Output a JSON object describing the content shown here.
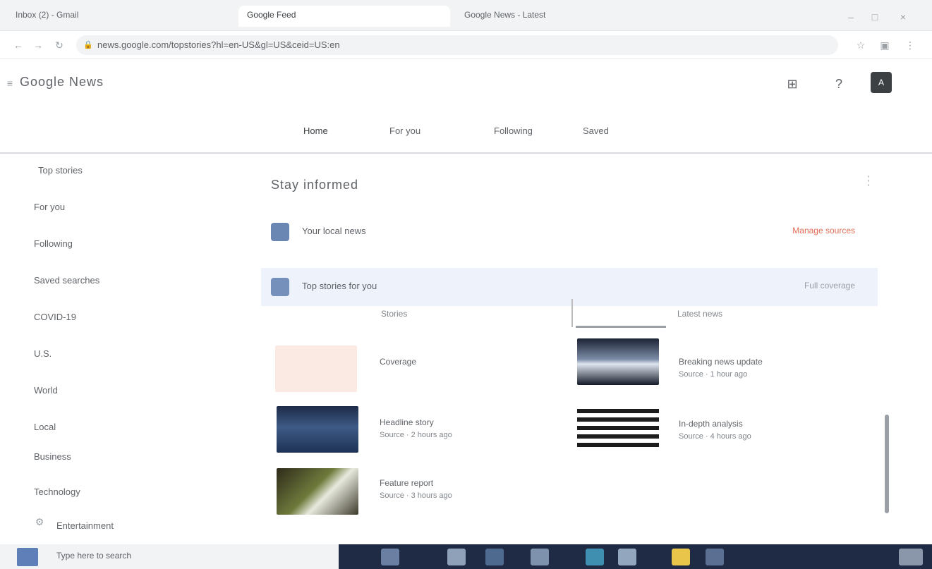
{
  "browser": {
    "tabs": [
      {
        "label": "Inbox (2) - Gmail"
      },
      {
        "label": "Google Feed"
      },
      {
        "label": "Google News - Latest"
      }
    ],
    "url": "news.google.com/topstories?hl=en-US&gl=US&ceid=US:en",
    "lock_icon": "lock-icon"
  },
  "app": {
    "brand": "Google News",
    "nav_tabs": [
      "Home",
      "For you",
      "Following",
      "Saved"
    ],
    "avatar_initial": "A"
  },
  "sidebar": {
    "items": [
      {
        "label": "Top stories"
      },
      {
        "label": "For you"
      },
      {
        "label": "Following"
      },
      {
        "label": "Saved searches"
      },
      {
        "label": "COVID-19"
      },
      {
        "label": "U.S."
      },
      {
        "label": "World"
      },
      {
        "label": "Local"
      },
      {
        "label": "Business"
      },
      {
        "label": "Technology"
      },
      {
        "label": "Entertainment"
      }
    ]
  },
  "main": {
    "title": "Stay informed",
    "rows": [
      {
        "title": "Your local news",
        "meta": "Manage sources"
      },
      {
        "title": "Top stories for you",
        "meta": "Full coverage"
      }
    ],
    "col_headers": [
      "Stories",
      "Latest news"
    ],
    "cards_left": [
      {
        "title": "Coverage",
        "sub": ""
      },
      {
        "title": "Headline story",
        "sub": "Source · 2 hours ago"
      },
      {
        "title": "Feature report",
        "sub": "Source · 3 hours ago"
      }
    ],
    "cards_right": [
      {
        "title": "Breaking news update",
        "sub": "Source · 1 hour ago"
      },
      {
        "title": "In-depth analysis",
        "sub": "Source · 4 hours ago"
      }
    ]
  },
  "taskbar": {
    "label": "Type here to search"
  },
  "colors": {
    "accent": "#6a86b3",
    "taskbar": "#1f2a44",
    "highlight_row": "#eef3fb",
    "meta_red": "#e26d55"
  }
}
